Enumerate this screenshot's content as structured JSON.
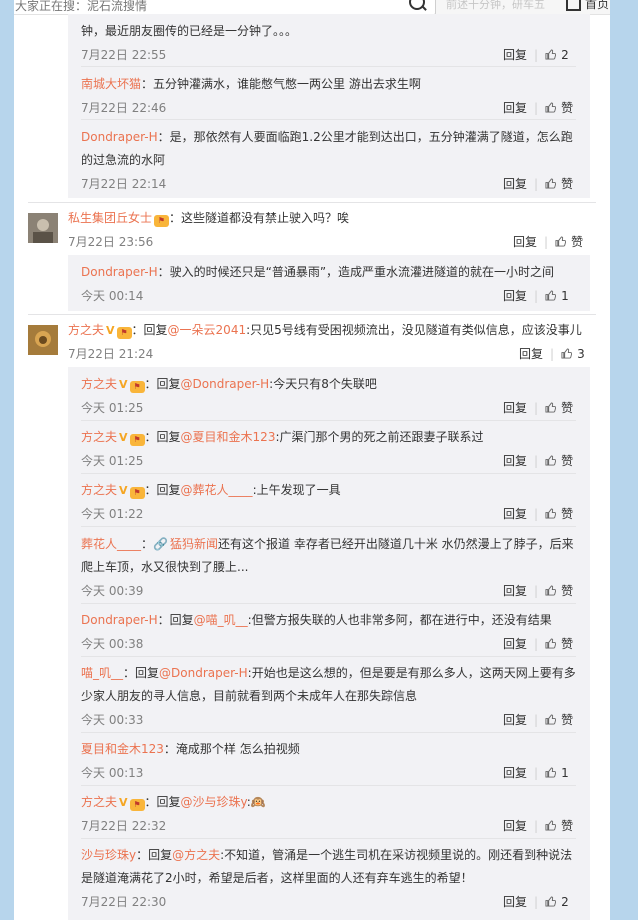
{
  "topbar": {
    "search_placeholder": "大家正在搜：泥石流搜情",
    "notice": "前述十分钟，研车五",
    "home_label": "首页"
  },
  "comments": [
    {
      "id": "c0",
      "continued_text": "钟，最近朋友圈传的已经是一分钟了。。。",
      "time": "7月22日 22:55",
      "reply_label": "回复",
      "likes": "2",
      "replies": [
        {
          "user": "南城大坏猫",
          "text": "：五分钟灌满水，谁能憋气憋一两公里 游出去求生啊",
          "time": "7月22日 22:46",
          "reply_label": "回复",
          "likes": "赞"
        },
        {
          "user": "Dondraper-H",
          "text": "：是，那依然有人要面临跑1.2公里才能到达出口，五分钟灌满了隧道，怎么跑的过急流的水阿",
          "time": "7月22日 22:14",
          "reply_label": "回复",
          "likes": "赞"
        }
      ]
    },
    {
      "id": "c1",
      "user": "私生集团丘女士",
      "text": "：这些隧道都没有禁止驶入吗？唉",
      "time": "7月22日 23:56",
      "reply_label": "回复",
      "likes": "赞",
      "replies": [
        {
          "user": "Dondraper-H",
          "text": "：驶入的时候还只是“普通暴雨”，造成严重水流灌进隧道的就在一小时之间",
          "time": "今天 00:14",
          "reply_label": "回复",
          "likes": "1"
        }
      ]
    },
    {
      "id": "c2",
      "user": "方之夫",
      "reply_prefix": "：回复",
      "mention": "@一朵云2041",
      "text": ":只见5号线有受困视频流出，没见隧道有类似信息，应该没事儿",
      "time": "7月22日 21:24",
      "reply_label": "回复",
      "likes": "3",
      "replies": [
        {
          "user": "方之夫",
          "prefix": "：回复",
          "mention": "@Dondraper-H",
          "text": ":今天只有8个失联吧",
          "time": "今天 01:25",
          "reply_label": "回复",
          "likes": "赞"
        },
        {
          "user": "方之夫",
          "prefix": "：回复",
          "mention": "@夏目和金木123",
          "text": ":广渠门那个男的死之前还跟妻子联系过",
          "time": "今天 01:25",
          "reply_label": "回复",
          "likes": "赞"
        },
        {
          "user": "方之夫",
          "prefix": "：回复",
          "mention": "@葬花人____",
          "text": ":上午发现了一具",
          "time": "今天 01:22",
          "reply_label": "回复",
          "likes": "赞"
        },
        {
          "user": "葬花人____",
          "prefix": "：",
          "mention": "猛犸新闻",
          "text": "还有这个报道 幸存者已经开出隧道几十米 水仍然漫上了脖子，后来爬上车顶，水又很快到了腰上...",
          "time": "今天 00:39",
          "reply_label": "回复",
          "likes": "赞"
        },
        {
          "user": "Dondraper-H",
          "prefix": "：回复",
          "mention": "@喵_叽__",
          "text": ":但警方报失联的人也非常多阿，都在进行中，还没有结果",
          "time": "今天 00:38",
          "reply_label": "回复",
          "likes": "赞"
        },
        {
          "user": "喵_叽__",
          "prefix": "：回复",
          "mention": "@Dondraper-H",
          "text": ":开始也是这么想的，但是要是有那么多人，这两天网上要有多少家人朋友的寻人信息，目前就看到两个未成年人在那失踪信息",
          "time": "今天 00:33",
          "reply_label": "回复",
          "likes": "赞"
        },
        {
          "user": "夏目和金木123",
          "prefix": "",
          "mention": "",
          "text": "：淹成那个样 怎么拍视频",
          "time": "今天 00:13",
          "reply_label": "回复",
          "likes": "1"
        },
        {
          "user": "方之夫",
          "prefix": "：回复",
          "mention": "@沙与珍珠y",
          "text": ":🙉",
          "time": "7月22日 22:32",
          "reply_label": "回复",
          "likes": "赞"
        },
        {
          "user": "沙与珍珠y",
          "prefix": "：回复",
          "mention": "@方之夫",
          "text": ":不知道，管涌是一个逃生司机在采访视频里说的。刚还看到种说法是隧道淹满花了2小时，希望是后者，这样里面的人还有弃车逃生的希望！",
          "time": "7月22日 22:30",
          "reply_label": "回复",
          "likes": "2"
        }
      ]
    }
  ]
}
